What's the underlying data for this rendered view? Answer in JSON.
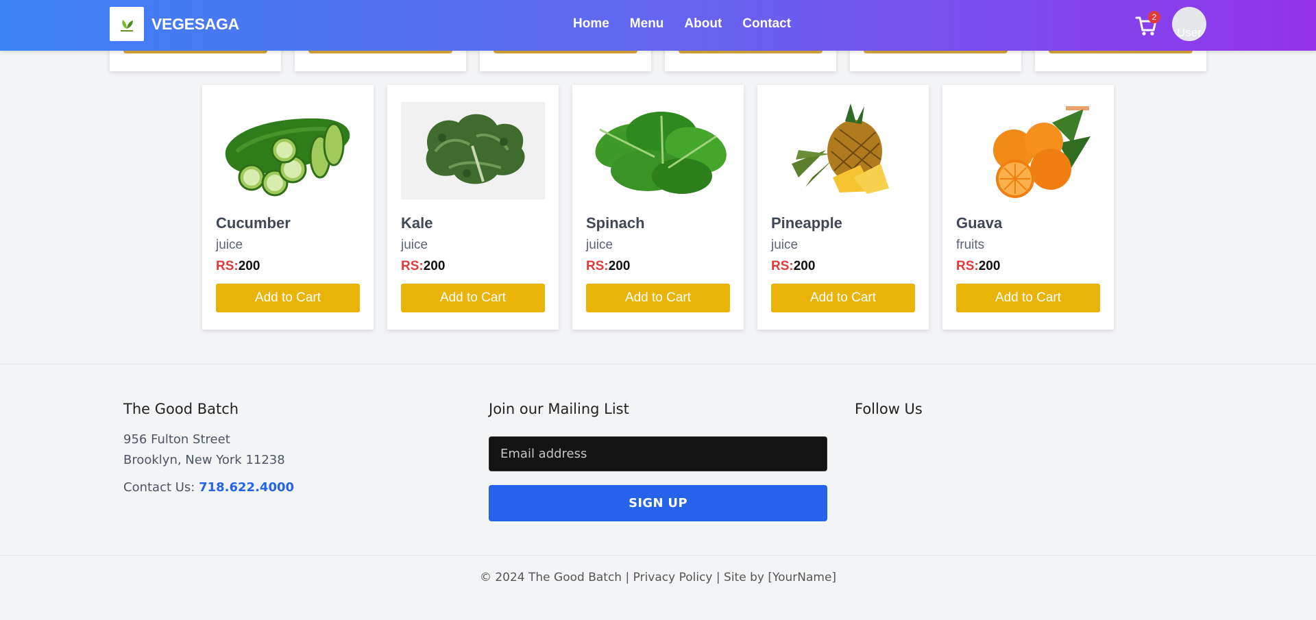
{
  "nav": {
    "brand": "VEGESAGA",
    "links": [
      "Home",
      "Menu",
      "About",
      "Contact"
    ],
    "cart_count": "2",
    "avatar_alt": "User"
  },
  "products": [
    {
      "name": "Cucumber",
      "category": "juice",
      "currency": "RS:",
      "price": "200",
      "button": "Add to Cart",
      "image": "cucumber"
    },
    {
      "name": "Kale",
      "category": "juice",
      "currency": "RS:",
      "price": "200",
      "button": "Add to Cart",
      "image": "kale"
    },
    {
      "name": "Spinach",
      "category": "juice",
      "currency": "RS:",
      "price": "200",
      "button": "Add to Cart",
      "image": "spinach"
    },
    {
      "name": "Pineapple",
      "category": "juice",
      "currency": "RS:",
      "price": "200",
      "button": "Add to Cart",
      "image": "pineapple"
    },
    {
      "name": "Guava",
      "category": "fruits",
      "currency": "RS:",
      "price": "200",
      "button": "Add to Cart",
      "image": "oranges"
    }
  ],
  "footer": {
    "company": {
      "title": "The Good Batch",
      "address1": "956 Fulton Street",
      "address2": "Brooklyn, New York 11238",
      "contact_label": "Contact Us: ",
      "phone": "718.622.4000"
    },
    "mailing": {
      "title": "Join our Mailing List",
      "placeholder": "Email address",
      "button": "SIGN UP"
    },
    "follow": {
      "title": "Follow Us"
    },
    "copyright": "© 2024 The Good Batch",
    "privacy": "Privacy Policy",
    "site_by": "Site by [YourName]",
    "separator": " | "
  },
  "colors": {
    "nav_gradient_start": "#3b82f6",
    "nav_gradient_end": "#9333ea",
    "add_to_cart": "#eab308",
    "price_currency": "#e23a3a",
    "signup": "#2563eb"
  }
}
